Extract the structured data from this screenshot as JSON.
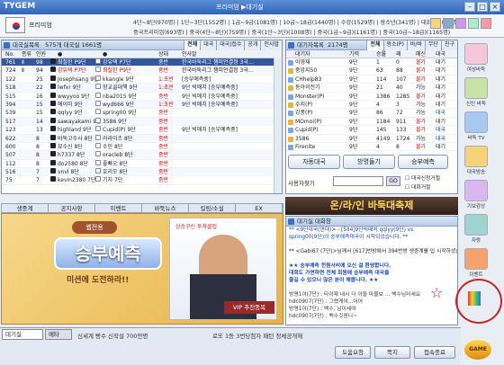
{
  "window": {
    "title": "프리미엄 ▶대기실",
    "logo": "TYGEM"
  },
  "header": {
    "user": "프리미엄",
    "stats_line1": "4단~8단(970명) | 1단~3단(1552명) | 1급~9급(1081명) | 10급~18급(1440명) | 수강(1529명) | 왕소년(341명) | 대회서버(16명)",
    "stats_line2": "중국프리미엄(693명) | 중국(4단~8단)(759명) | 중국(1단~3단)(1008명) | 중국(1급~9급)(1161명) | 중국(10급~18급)(1165명)"
  },
  "games": {
    "title": "대국실목록",
    "count_text": "575개 대국실  1661명",
    "tabs": [
      "전체",
      "대국",
      "대국|접수",
      "공개",
      "인사말"
    ],
    "columns": [
      "No.",
      "종류",
      "인원",
      "●",
      "●",
      "상태",
      "인사말"
    ],
    "rows": [
      {
        "no": "761",
        "kind": "Ⅱ",
        "people": "98",
        "black": "최철한 P9단",
        "white": "강유택 P7단",
        "status": "중반",
        "note": "한국바둑리그 챔피언결정 3국…",
        "sel": true
      },
      {
        "no": "724",
        "kind": "Ⅱ",
        "people": "94",
        "black": "강유택 P7단",
        "white": "최철한 P9단",
        "status": "중반",
        "note": "한국바둑리그 챔피언결정 3국…",
        "sel": false
      },
      {
        "no": "122",
        "kind": "",
        "people": "25",
        "black": "Josephsang 9단",
        "white": "kkangle 9단",
        "status": "1:초반",
        "note": "[승부예측중]",
        "sel": false
      },
      {
        "no": "518",
        "kind": "",
        "people": "22",
        "black": "lwfxr 9단",
        "white": "향교골대책 9단",
        "status": "1:초반",
        "note": "9단 빅매치 [승부예측중]",
        "sel": false
      },
      {
        "no": "515",
        "kind": "",
        "people": "16",
        "black": "wwyyoo 9단",
        "white": "nba2015 9단",
        "status": "중반",
        "note": "9단 빅매치 [승부예측중]",
        "sel": false
      },
      {
        "no": "394",
        "kind": "",
        "people": "15",
        "black": "에이미 9단",
        "white": "wyd666 9단",
        "status": "1:초반",
        "note": "9단 빅매치 [승부예측중]",
        "sel": false
      },
      {
        "no": "539",
        "kind": "",
        "people": "15",
        "black": "qqlyy 9단",
        "white": "spring00 9단",
        "status": "중반",
        "note": "",
        "sel": false
      },
      {
        "no": "517",
        "kind": "",
        "people": "14",
        "black": "sawayakami 9단",
        "white": "3586 9단",
        "status": "중반",
        "note": "",
        "sel": false
      },
      {
        "no": "123",
        "kind": "",
        "people": "13",
        "black": "highland 9단",
        "white": "Cupid(P) 9단",
        "status": "중반",
        "note": "9단 빅매치 [승부예측중]",
        "sel": false
      },
      {
        "no": "622",
        "kind": "",
        "people": "8",
        "black": "바둑고수사 8단",
        "white": "라라이츠 8단",
        "status": "중반",
        "note": "",
        "sel": false
      },
      {
        "no": "600",
        "kind": "",
        "people": "8",
        "black": "묘수신 8단",
        "white": "수인 8단",
        "status": "중반",
        "note": "",
        "sel": false
      },
      {
        "no": "507",
        "kind": "",
        "people": "8",
        "black": "h7337 8단",
        "white": "oracleb 8단",
        "status": "중반",
        "note": "",
        "sel": false
      },
      {
        "no": "112",
        "kind": "",
        "people": "8",
        "black": "do2580 8단",
        "white": "좋빠오 8단",
        "status": "중반",
        "note": "",
        "sel": false
      },
      {
        "no": "516",
        "kind": "",
        "people": "7",
        "black": "vnvl 8단",
        "white": "호리오 8단",
        "status": "중반",
        "note": "",
        "sel": false
      },
      {
        "no": "75",
        "kind": "",
        "people": "7",
        "black": "kevin2380 7단",
        "white": "기지 7단",
        "status": "중반",
        "note": "",
        "sel": false
      }
    ]
  },
  "waiting": {
    "title": "대기자목록",
    "count_text": "2174명",
    "tabs": [
      "전체",
      "왕소(P)",
      "바/바",
      "무단",
      "친구"
    ],
    "columns": [
      "대기자",
      "기력",
      "승률",
      "패",
      "메신",
      "대국"
    ],
    "rows": [
      {
        "name": "이영재",
        "rank": "9단",
        "win": "1",
        "loss": "0",
        "state": "불가",
        "mode": "대기"
      },
      {
        "name": "중앙지50",
        "rank": "9단",
        "win": "63",
        "loss": "88",
        "state": "불가",
        "mode": "대기"
      },
      {
        "name": "CHhelp83",
        "rank": "9단",
        "win": "114",
        "loss": "107",
        "state": "불가",
        "mode": "대기"
      },
      {
        "name": "동아의전기",
        "rank": "9단",
        "win": "21",
        "loss": "40",
        "state": "가능",
        "mode": "대기"
      },
      {
        "name": "Monster(P)",
        "rank": "9단",
        "win": "1386",
        "loss": "1285",
        "state": "불가",
        "mode": "대기"
      },
      {
        "name": "수지(P)",
        "rank": "9단",
        "win": "4",
        "loss": "3",
        "state": "가능",
        "mode": "대기"
      },
      {
        "name": "강풍(P)",
        "rank": "9단",
        "win": "86",
        "loss": "72",
        "state": "가능",
        "mode": "대국"
      },
      {
        "name": "MOmoi(P)",
        "rank": "9단",
        "win": "1184",
        "loss": "911",
        "state": "불가",
        "mode": "대기"
      },
      {
        "name": "Cupid(P)",
        "rank": "9단",
        "win": "145",
        "loss": "133",
        "state": "불가",
        "mode": "대국"
      },
      {
        "name": "3586",
        "rank": "9단",
        "win": "4149",
        "loss": "1724",
        "state": "가능",
        "mode": "대국"
      },
      {
        "name": "Firenite",
        "rank": "9단",
        "win": "4",
        "loss": "8",
        "state": "불가",
        "mode": "대기"
      }
    ],
    "buttons": {
      "quick": "자동대국",
      "visit": "방명들기",
      "predict": "승부예측"
    },
    "search_label": "사용자찾기",
    "search_go": "GO",
    "opt1": "대국신청거절",
    "opt2": "대화거절"
  },
  "promo": {
    "tabs": [
      "생중계",
      "공지사항",
      "이벤트",
      "바둑뉴스",
      "킬링/소설",
      "EX"
    ],
    "badge": "웹전용",
    "headline": "승부예측",
    "sub": "미션에 도전하라!!",
    "ad_brand": "상승구신 투자클럽",
    "ad_tag": "VIP 추천종목"
  },
  "chat": {
    "header_banner": "온/라/인 바둑대축제",
    "title": "대기실 대화창",
    "lines": [
      "** <9단대국(연대)> - [584]9단빅매치 qqlyy(9단)  vs",
      "spring00(9단)의 승부예측대국이 시작되었습니다. **",
      "",
      "** <Gabi67 (7단)>님께서 [617]번방에서 394번방 생중계를 입 시작하셨습니다.",
      "",
      "★★ 승부예측 전원서비에 오신 걸 환영합니다.",
      "대회도 가면하면 전체 회원에 승부예측 대국을",
      "즐길 수 있으니 많은 분이 해봅니다. ★★",
      "",
      "방명1이(7단) : 타이제 네시 더 아들 마블보 ... 백수님미세요",
      "hdc0907(7단) : 그랬게여...어어",
      "방명1이(7단) : 백수, 남이세여",
      "hdc0907(7단) : 백수깃옴니~"
    ]
  },
  "sidebar": {
    "items": [
      "여성바둑",
      "신인 바둑",
      "바둑 TV",
      "대국방송",
      "기보감상",
      "자랑",
      "이벤트"
    ]
  },
  "bottom": {
    "left_tabs": [
      "대기실",
      "메타"
    ],
    "notice": "신세계 빵수 신작설 700만명",
    "ticker": "로또 1등 3번당첨자 패턴 정체공개해",
    "buttons": [
      "도움요청",
      "쪽지",
      "접속종료"
    ],
    "game_btn": "GAME"
  },
  "colors": {
    "accent": "#2f63b8",
    "selected": "#32579a",
    "warn": "#c11",
    "link": "#1846b8",
    "annotation": "#cc2222"
  }
}
